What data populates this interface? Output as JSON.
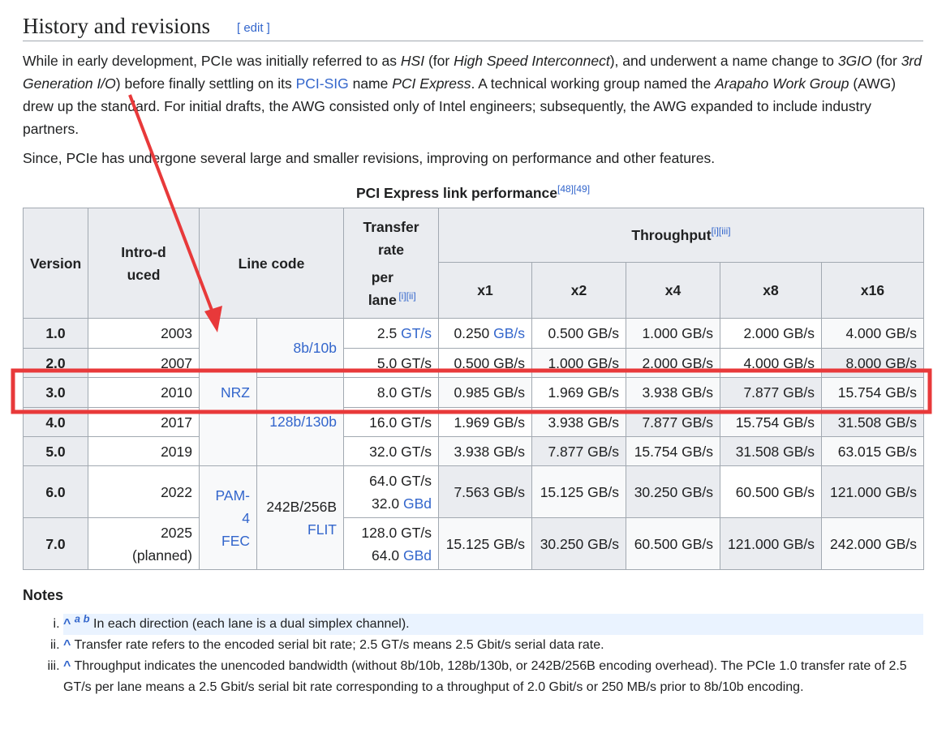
{
  "heading": {
    "title": "History and revisions",
    "edit": "[ edit ]"
  },
  "para1": {
    "s1": "While in early development, PCIe was initially referred to as ",
    "hsi": "HSI",
    "s2": " (for ",
    "hsi_full": "High Speed Interconnect",
    "s3": "), and underwent a name change to ",
    "g3": "3GIO",
    "s4": " (for ",
    "g3_full": "3rd Generation I/O",
    "s5": ") before finally settling on its ",
    "pcisig": "PCI-SIG",
    "s6": " name ",
    "pcie": "PCI Express",
    "s7": ". A technical working group named the ",
    "awg": "Arapaho Work Group",
    "s8": " (AWG) drew up the standard. For initial drafts, the AWG consisted only of Intel engineers; subsequently, the AWG expanded to include industry partners."
  },
  "para2": "Since, PCIe has undergone several large and smaller revisions, improving on performance and other features.",
  "table": {
    "caption": "PCI Express link performance",
    "caption_refs": "[48][49]",
    "headers": {
      "version": "Version",
      "introduced": "Intro-duced",
      "line_code": "Line code",
      "transfer_rate": "Transfer rate",
      "per_lane": "per lane",
      "per_lane_refs": "[i][ii]",
      "throughput": "Throughput",
      "throughput_refs": "[i][iii]",
      "lanes": [
        "x1",
        "x2",
        "x4",
        "x8",
        "x16"
      ]
    },
    "rows": [
      {
        "version": "1.0",
        "introduced": "2003",
        "rate": [
          "2.5 ",
          "GT/s"
        ],
        "throughput": [
          [
            "0.250 ",
            "GB/s",
            "w"
          ],
          [
            "0.500 GB/s",
            "",
            "w"
          ],
          [
            "1.000 GB/s",
            "",
            "l"
          ],
          [
            "2.000 GB/s",
            "",
            "w"
          ],
          [
            "4.000 GB/s",
            "",
            "l"
          ]
        ]
      },
      {
        "version": "2.0",
        "introduced": "2007",
        "rate": [
          "5.0 GT/s",
          ""
        ],
        "throughput": [
          [
            "0.500 GB/s",
            "",
            "w"
          ],
          [
            "1.000 GB/s",
            "",
            "l"
          ],
          [
            "2.000 GB/s",
            "",
            "l"
          ],
          [
            "4.000 GB/s",
            "",
            "w"
          ],
          [
            "8.000 GB/s",
            "",
            "g"
          ]
        ]
      },
      {
        "version": "3.0",
        "introduced": "2010",
        "rate": [
          "8.0 GT/s",
          ""
        ],
        "throughput": [
          [
            "0.985 GB/s",
            "",
            "l"
          ],
          [
            "1.969 GB/s",
            "",
            "w"
          ],
          [
            "3.938 GB/s",
            "",
            "l"
          ],
          [
            "7.877 GB/s",
            "",
            "g"
          ],
          [
            "15.754 GB/s",
            "",
            "l"
          ]
        ]
      },
      {
        "version": "4.0",
        "introduced": "2017",
        "rate": [
          "16.0 GT/s",
          ""
        ],
        "throughput": [
          [
            "1.969 GB/s",
            "",
            "w"
          ],
          [
            "3.938 GB/s",
            "",
            "l"
          ],
          [
            "7.877 GB/s",
            "",
            "g"
          ],
          [
            "15.754 GB/s",
            "",
            "l"
          ],
          [
            "31.508 GB/s",
            "",
            "g"
          ]
        ]
      },
      {
        "version": "5.0",
        "introduced": "2019",
        "rate": [
          "32.0 GT/s",
          ""
        ],
        "throughput": [
          [
            "3.938 GB/s",
            "",
            "l"
          ],
          [
            "7.877 GB/s",
            "",
            "g"
          ],
          [
            "15.754 GB/s",
            "",
            "l"
          ],
          [
            "31.508 GB/s",
            "",
            "g"
          ],
          [
            "63.015 GB/s",
            "",
            "l"
          ]
        ]
      },
      {
        "version": "6.0",
        "introduced": "2022",
        "rate": [
          "64.0 GT/s",
          ""
        ],
        "baud": [
          "32.0 ",
          "GBd"
        ],
        "throughput": [
          [
            "7.563 GB/s",
            "",
            "g"
          ],
          [
            "15.125 GB/s",
            "",
            "l"
          ],
          [
            "30.250 GB/s",
            "",
            "g"
          ],
          [
            "60.500 GB/s",
            "",
            "w"
          ],
          [
            "121.000 GB/s",
            "",
            "g"
          ]
        ]
      },
      {
        "version": "7.0",
        "introduced": "2025",
        "introduced_note": "(planned)",
        "rate": [
          "128.0 GT/s",
          ""
        ],
        "baud": [
          "64.0 ",
          "GBd"
        ],
        "throughput": [
          [
            "15.125 GB/s",
            "",
            "l"
          ],
          [
            "30.250 GB/s",
            "",
            "g"
          ],
          [
            "60.500 GB/s",
            "",
            "l"
          ],
          [
            "121.000 GB/s",
            "",
            "g"
          ],
          [
            "242.000 GB/s",
            "",
            "l"
          ]
        ]
      }
    ],
    "line_codes": {
      "nrz": "NRZ",
      "enc_8b10b": "8b/10b",
      "enc_128b130b": "128b/130b",
      "pam4_a": "PAM-",
      "pam4_b": "4",
      "fec": "FEC",
      "enc_242b": "242B/256B",
      "flit": "FLIT"
    }
  },
  "notes": {
    "title": "Notes",
    "items": [
      {
        "caret": "^",
        "backrefs": "a b",
        "text": "In each direction (each lane is a dual simplex channel)."
      },
      {
        "caret": "^",
        "text": "Transfer rate refers to the encoded serial bit rate; 2.5 GT/s means 2.5 Gbit/s serial data rate."
      },
      {
        "caret": "^",
        "text": "Throughput indicates the unencoded bandwidth (without 8b/10b, 128b/130b, or 242B/256B encoding overhead). The PCIe 1.0 transfer rate of 2.5 GT/s per lane means a 2.5 Gbit/s serial bit rate corresponding to a throughput of 2.0 Gbit/s or 250 MB/s prior to 8b/10b encoding."
      }
    ]
  },
  "annotation": {
    "color": "#e8393a",
    "highlighted_row": "3.0"
  }
}
